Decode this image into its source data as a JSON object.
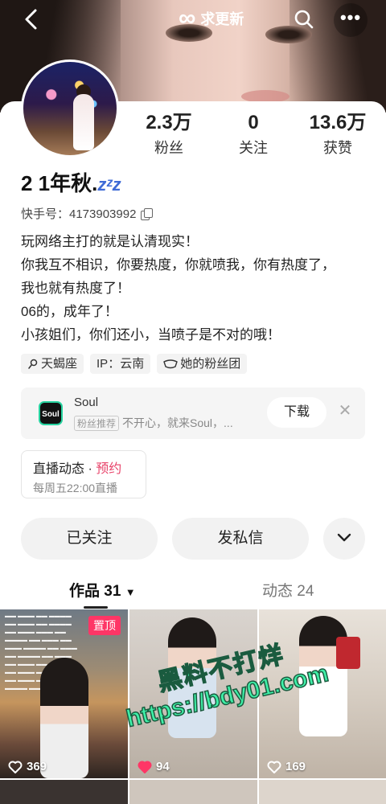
{
  "header": {
    "update_label": "求更新"
  },
  "profile": {
    "name": "2 1年秋.",
    "name_emoji": "zᶻz",
    "kuaishou_id": "快手号：4173903992",
    "stats": [
      {
        "value": "2.3万",
        "label": "粉丝"
      },
      {
        "value": "0",
        "label": "关注"
      },
      {
        "value": "13.6万",
        "label": "获赞"
      }
    ],
    "bio": [
      "玩网络主打的就是认清现实！",
      "你我互不相识，你要热度，你就喷我，你有热度了，",
      "我也就有热度了！",
      "06的，成年了！",
      "小孩姐们，你们还小，当喷子是不对的哦！"
    ],
    "tags": [
      {
        "icon": "location-pin-icon",
        "label": "天蝎座"
      },
      {
        "icon": "",
        "label": "IP：云南"
      },
      {
        "icon": "fan-club-icon",
        "label": "她的粉丝团"
      }
    ]
  },
  "ad": {
    "logo_text": "Soul",
    "title": "Soul",
    "badge": "粉丝推荐",
    "subtitle": "不开心，就来Soul，...",
    "button": "下载"
  },
  "live": {
    "title": "直播动态 · ",
    "highlight": "预约",
    "schedule": "每周五22:00直播"
  },
  "actions": {
    "follow": "已关注",
    "message": "发私信"
  },
  "tabs": {
    "works": "作品 31",
    "moments": "动态 24"
  },
  "grid": [
    {
      "pinned": "置顶",
      "likes": "369",
      "liked": false
    },
    {
      "pinned": "",
      "likes": "94",
      "liked": true
    },
    {
      "pinned": "",
      "likes": "169",
      "liked": false
    }
  ],
  "watermark": {
    "line1": "黑料不打烊",
    "line2": "https://bdy01.com"
  },
  "colors": {
    "accent_pink": "#fe3666",
    "watermark_green": "#3ff0a8"
  }
}
